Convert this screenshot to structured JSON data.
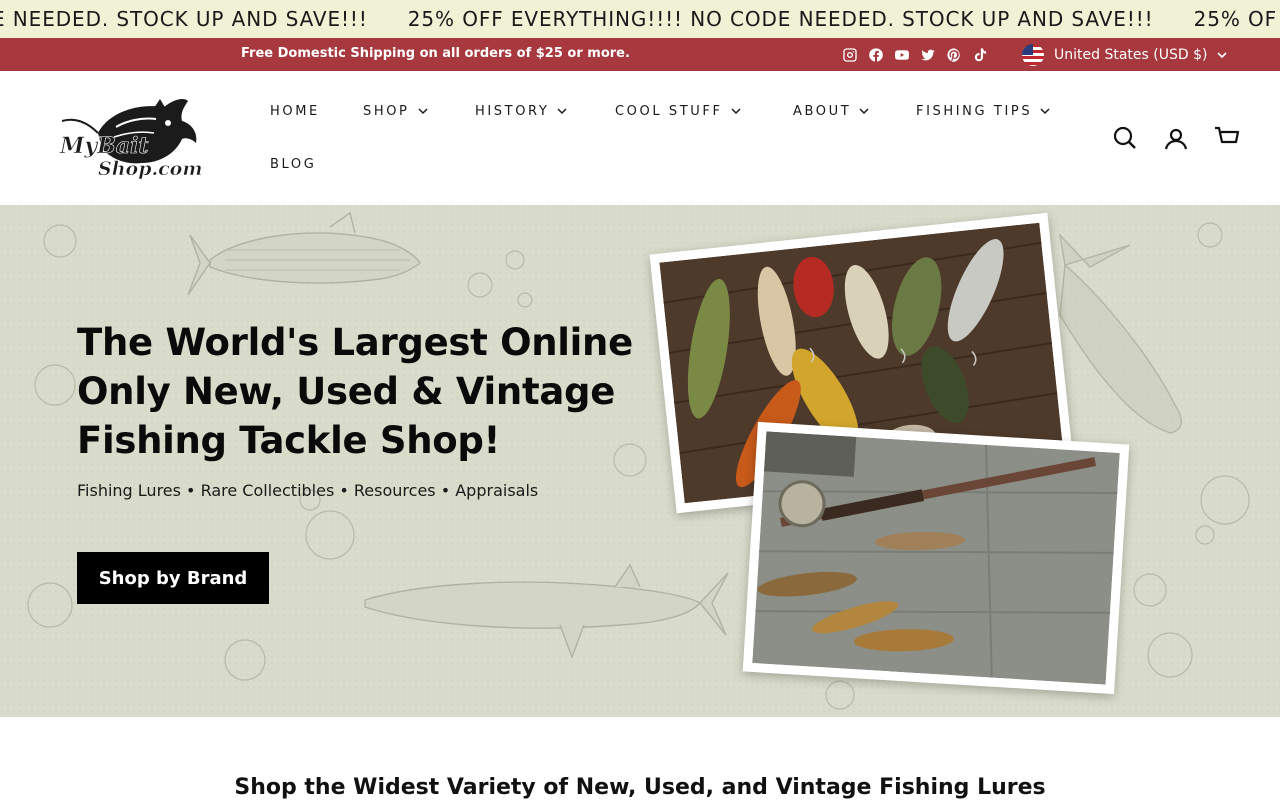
{
  "marquee": {
    "items": [
      "E NEEDED. STOCK UP AND SAVE!!!",
      "25% OFF EVERYTHING!!!! NO CODE NEEDED. STOCK UP AND SAVE!!!",
      "25% OF"
    ]
  },
  "announcement": {
    "text": "Free Domestic Shipping on all orders of $25 or more.",
    "socials": [
      "instagram-icon",
      "facebook-icon",
      "youtube-icon",
      "twitter-icon",
      "pinterest-icon",
      "tiktok-icon"
    ],
    "currency": "United States (USD $)"
  },
  "header": {
    "logo_text": "MyBait Shop.com",
    "nav": [
      {
        "label": "HOME",
        "dropdown": false
      },
      {
        "label": "SHOP",
        "dropdown": true
      },
      {
        "label": "HISTORY",
        "dropdown": true
      },
      {
        "label": "COOL STUFF",
        "dropdown": true
      },
      {
        "label": "ABOUT",
        "dropdown": true
      },
      {
        "label": "FISHING TIPS",
        "dropdown": true
      },
      {
        "label": "BLOG",
        "dropdown": false
      }
    ],
    "icons": [
      "search-icon",
      "account-icon",
      "cart-icon"
    ]
  },
  "hero": {
    "title": "The World's Largest Online Only New, Used & Vintage Fishing Tackle Shop!",
    "subtitle": "Fishing Lures • Rare Collectibles • Resources • Appraisals",
    "button": "Shop by Brand"
  },
  "section": {
    "title": "Shop the Widest Variety of New, Used, and Vintage Fishing Lures"
  },
  "colors": {
    "marquee_bg": "#f1f1d6",
    "announce_bg": "#a6383e",
    "hero_bg": "#d9dccb",
    "button_bg": "#000000"
  }
}
